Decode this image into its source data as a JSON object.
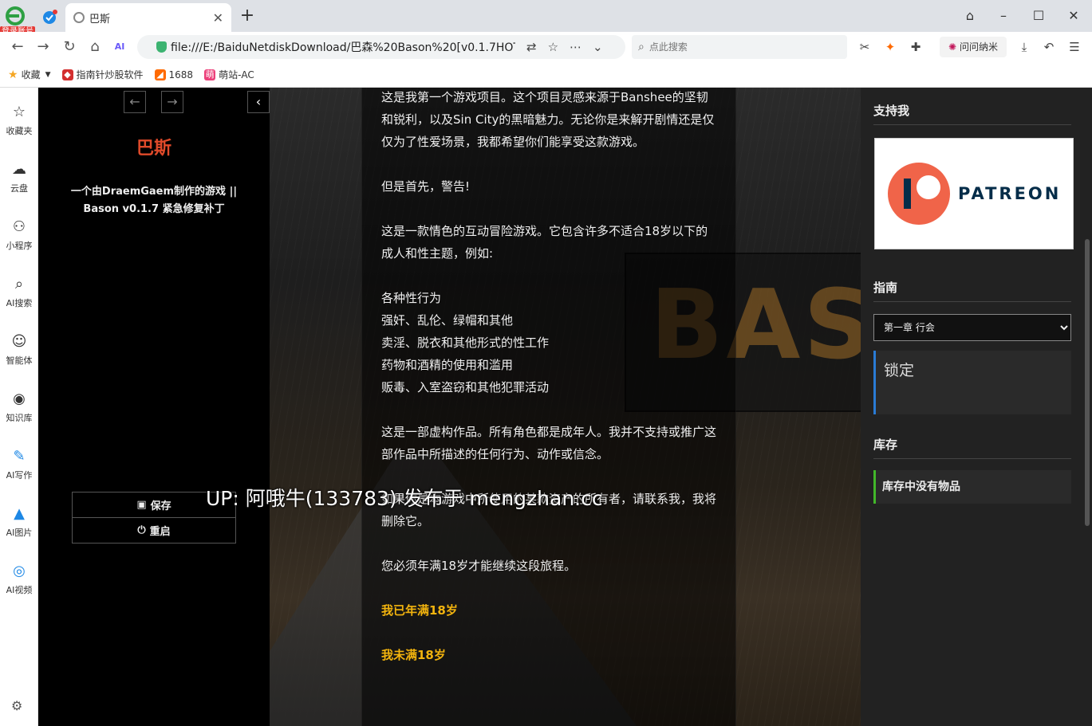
{
  "browser": {
    "login_badge": "登录账号",
    "tab_title": "巴斯",
    "tab_close": "✕",
    "new_tab": "+",
    "url": "file:///E:/BaiduNetdiskDownload/巴森%20Bason%20[v0.1.7HOTFI",
    "search_placeholder": "点此搜索",
    "ask_label": "问问纳米",
    "bookmarks": [
      {
        "label": "收藏",
        "color": "#f5a623"
      },
      {
        "label": "指南针炒股软件",
        "color": "#d32f2f"
      },
      {
        "label": "1688",
        "color": "#ff6a00"
      },
      {
        "label": "萌站-AC",
        "color": "#ec407a"
      }
    ]
  },
  "leftbar": {
    "items": [
      {
        "label": "收藏夹",
        "icon": "☆"
      },
      {
        "label": "云盘",
        "icon": "☁"
      },
      {
        "label": "小程序",
        "icon": "⚇"
      },
      {
        "label": "AI搜索",
        "icon": "⌕"
      },
      {
        "label": "智能体",
        "icon": "☺"
      },
      {
        "label": "知识库",
        "icon": "◉"
      },
      {
        "label": "AI写作",
        "icon": "✎"
      },
      {
        "label": "AI图片",
        "icon": "▲"
      },
      {
        "label": "AI视频",
        "icon": "◎"
      }
    ],
    "settings_icon": "⚙"
  },
  "story": {
    "title": "巴斯",
    "subtitle": "一个由DraemGaem制作的游戏 || Bason v0.1.7 紧急修复补丁",
    "save_label": "保存",
    "restart_label": "重启"
  },
  "passage": {
    "paragraphs": [
      "这是我第一个游戏项目。这个项目灵感来源于Banshee的坚韧和锐利，以及Sin City的黑暗魅力。无论你是来解开剧情还是仅仅为了性爱场景，我都希望你们能享受这款游戏。",
      "但是首先，警告!",
      "这是一款情色的互动冒险游戏。它包含许多不适合18岁以下的成人和性主题，例如:",
      "各种性行为\n强奸、乱伦、绿帽和其他\n卖淫、脱衣和其他形式的性工作\n药物和酒精的使用和滥用\n贩毒、入室盗窃和其他犯罪活动",
      "这是一部虚构作品。所有角色都是成年人。我并不支持或推广这部作品中所描述的任何行为、动作或信念。",
      "如果你是本游戏中所使用的某款资产的所有者，请联系我，我将删除它。",
      "您必须年满18岁才能继续这段旅程。"
    ],
    "link_adult": "我已年满18岁",
    "link_minor": "我未满18岁"
  },
  "right_panel": {
    "support_heading": "支持我",
    "patreon_word": "PATREON",
    "guide_heading": "指南",
    "chapter_selected": "第一章 行会",
    "lock_text": "锁定",
    "inventory_heading": "库存",
    "inventory_empty": "库存中没有物品"
  },
  "background_sign": "BAS",
  "watermark": "UP: 阿哦牛(133783) 发布于 mengzhan.cc"
}
